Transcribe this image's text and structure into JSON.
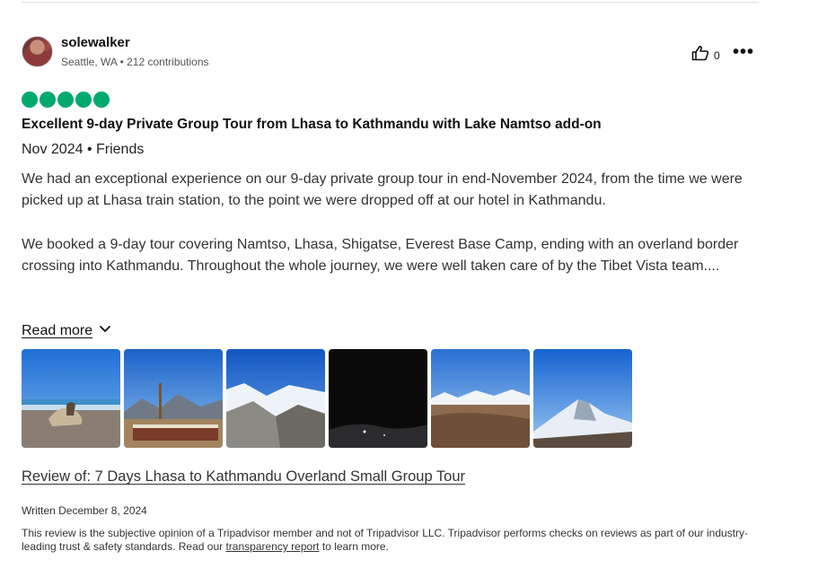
{
  "reviewer": {
    "name": "solewalker",
    "location_contributions": "Seattle, WA • 212 contributions"
  },
  "actions": {
    "helpful_count": "0",
    "helpful_icon": "thumbs-up-icon",
    "more_icon": "more-options-icon"
  },
  "rating": {
    "value": 5,
    "max": 5,
    "color": "#00aa6c"
  },
  "review": {
    "title": "Excellent 9-day Private Group Tour from Lhasa to Kathmandu with Lake Namtso add-on",
    "date_trip_type": "Nov 2024 • Friends",
    "paragraphs": [
      "We had an exceptional experience on our 9-day private group tour in end-November 2024, from the time we were picked up at Lhasa train station, to the point we were dropped off at our hotel in Kathmandu.",
      "We booked a 9-day tour covering Namtso, Lhasa, Shigatse, Everest Base Camp, ending with an overland border crossing into Kathmandu. Throughout the whole journey, we were well taken care of by the Tibet Vista team...."
    ],
    "read_more_label": "Read more",
    "review_of": "Review of: 7 Days Lhasa to Kathmandu Overland Small Group Tour",
    "written": "Written December 8, 2024"
  },
  "photos": [
    {
      "name": "photo-lake-shore"
    },
    {
      "name": "photo-monastery-flagpole"
    },
    {
      "name": "photo-glacier"
    },
    {
      "name": "photo-night-sky"
    },
    {
      "name": "photo-mountain-valley"
    },
    {
      "name": "photo-everest"
    }
  ],
  "disclaimer": {
    "text_before": "This review is the subjective opinion of a Tripadvisor member and not of Tripadvisor LLC. Tripadvisor performs checks on reviews as part of our industry-leading trust & safety standards. Read our ",
    "link_label": "transparency report",
    "text_after": " to learn more."
  }
}
